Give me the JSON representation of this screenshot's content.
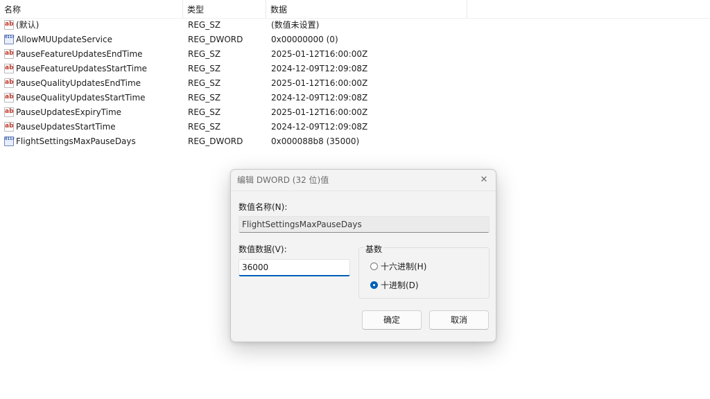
{
  "list": {
    "columns": [
      "名称",
      "类型",
      "数据"
    ],
    "rows": [
      {
        "icon": "reg-string-icon",
        "name": "(默认)",
        "type": "REG_SZ",
        "data": "(数值未设置)"
      },
      {
        "icon": "reg-dword-icon",
        "name": "AllowMUUpdateService",
        "type": "REG_DWORD",
        "data": "0x00000000 (0)"
      },
      {
        "icon": "reg-string-icon",
        "name": "PauseFeatureUpdatesEndTime",
        "type": "REG_SZ",
        "data": "2025-01-12T16:00:00Z"
      },
      {
        "icon": "reg-string-icon",
        "name": "PauseFeatureUpdatesStartTime",
        "type": "REG_SZ",
        "data": "2024-12-09T12:09:08Z"
      },
      {
        "icon": "reg-string-icon",
        "name": "PauseQualityUpdatesEndTime",
        "type": "REG_SZ",
        "data": "2025-01-12T16:00:00Z"
      },
      {
        "icon": "reg-string-icon",
        "name": "PauseQualityUpdatesStartTime",
        "type": "REG_SZ",
        "data": "2024-12-09T12:09:08Z"
      },
      {
        "icon": "reg-string-icon",
        "name": "PauseUpdatesExpiryTime",
        "type": "REG_SZ",
        "data": "2025-01-12T16:00:00Z"
      },
      {
        "icon": "reg-string-icon",
        "name": "PauseUpdatesStartTime",
        "type": "REG_SZ",
        "data": "2024-12-09T12:09:08Z"
      },
      {
        "icon": "reg-dword-icon",
        "name": "FlightSettingsMaxPauseDays",
        "type": "REG_DWORD",
        "data": "0x000088b8 (35000)"
      }
    ]
  },
  "dialog": {
    "title": "编辑 DWORD (32 位)值",
    "close_icon": "close-icon",
    "value_name_label": "数值名称(N):",
    "value_name": "FlightSettingsMaxPauseDays",
    "value_data_label": "数值数据(V):",
    "value_data": "36000",
    "base_label": "基数",
    "hex_label": "十六进制(H)",
    "dec_label": "十进制(D)",
    "selected_base": "decimal",
    "ok_label": "确定",
    "cancel_label": "取消"
  },
  "colors": {
    "accent": "#005fb8",
    "dialog_bg": "#f3f3f3"
  }
}
